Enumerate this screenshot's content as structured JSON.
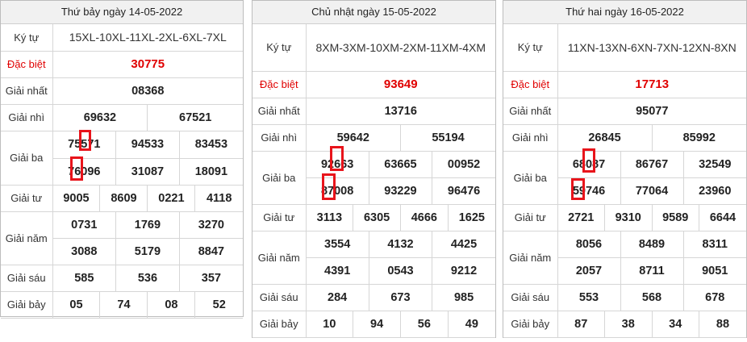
{
  "tables": [
    {
      "header": "Thứ bảy ngày 14-05-2022",
      "kytu_label": "Ký tự",
      "kytu_value": "15XL-10XL-11XL-2XL-6XL-7XL",
      "db_label": "Đặc biệt",
      "db": "30775",
      "g1_label": "Giải nhất",
      "g1": "08368",
      "g2_label": "Giải nhì",
      "g2": [
        "69632",
        "67521"
      ],
      "g3_label": "Giải ba",
      "g3": [
        "75571",
        "94533",
        "83453",
        "76096",
        "31087",
        "18091"
      ],
      "g4_label": "Giải tư",
      "g4": [
        "9005",
        "8609",
        "0221",
        "4118"
      ],
      "g5_label": "Giải năm",
      "g5": [
        "0731",
        "1769",
        "3270",
        "3088",
        "5179",
        "8847"
      ],
      "g6_label": "Giải sáu",
      "g6": [
        "585",
        "536",
        "357"
      ],
      "g7_label": "Giải bảy",
      "g7": [
        "05",
        "74",
        "08",
        "52"
      ]
    },
    {
      "header": "Chủ nhật ngày 15-05-2022",
      "kytu_label": "Ký tự",
      "kytu_value": "8XM-3XM-10XM-2XM-11XM-4XM",
      "db_label": "Đặc biệt",
      "db": "93649",
      "g1_label": "Giải nhất",
      "g1": "13716",
      "g2_label": "Giải nhì",
      "g2": [
        "59642",
        "55194"
      ],
      "g3_label": "Giải ba",
      "g3": [
        "92663",
        "63665",
        "00952",
        "87008",
        "93229",
        "96476"
      ],
      "g4_label": "Giải tư",
      "g4": [
        "3113",
        "6305",
        "4666",
        "1625"
      ],
      "g5_label": "Giải năm",
      "g5": [
        "3554",
        "4132",
        "4425",
        "4391",
        "0543",
        "9212"
      ],
      "g6_label": "Giải sáu",
      "g6": [
        "284",
        "673",
        "985"
      ],
      "g7_label": "Giải bảy",
      "g7": [
        "10",
        "94",
        "56",
        "49"
      ]
    },
    {
      "header": "Thứ hai ngày 16-05-2022",
      "kytu_label": "Ký tự",
      "kytu_value": "11XN-13XN-6XN-7XN-12XN-8XN",
      "db_label": "Đặc biệt",
      "db": "17713",
      "g1_label": "Giải nhất",
      "g1": "95077",
      "g2_label": "Giải nhì",
      "g2": [
        "26845",
        "85992"
      ],
      "g3_label": "Giải ba",
      "g3": [
        "68087",
        "86767",
        "32549",
        "59746",
        "77064",
        "23960"
      ],
      "g4_label": "Giải tư",
      "g4": [
        "2721",
        "9310",
        "9589",
        "6644"
      ],
      "g5_label": "Giải năm",
      "g5": [
        "8056",
        "8489",
        "8311",
        "2057",
        "8711",
        "9051"
      ],
      "g6_label": "Giải sáu",
      "g6": [
        "553",
        "568",
        "678"
      ],
      "g7_label": "Giải bảy",
      "g7": [
        "87",
        "38",
        "34",
        "88"
      ]
    }
  ],
  "colors": {
    "accent_red": "#e00000",
    "highlight_box": "#e8141b",
    "header_bg": "#f1f1f1"
  }
}
